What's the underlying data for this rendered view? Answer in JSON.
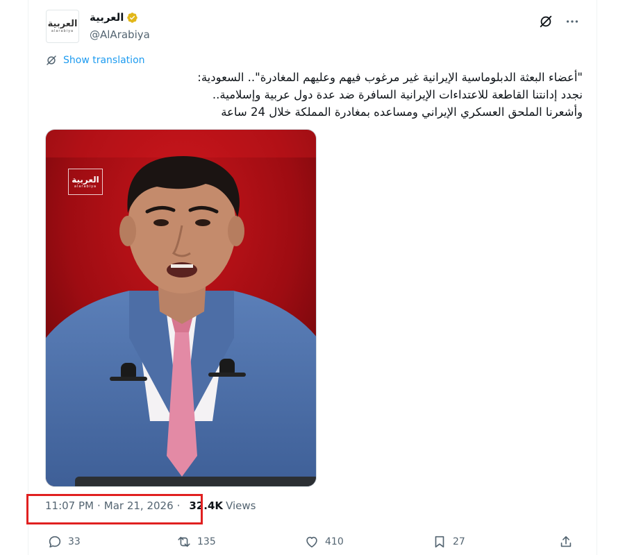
{
  "author": {
    "display_name": "العربية",
    "handle": "@AlArabiya",
    "avatar_logo_text": "العربية",
    "avatar_logo_sub": "alarabiya",
    "verified_color": "#e2b719"
  },
  "translation": {
    "label": "Show translation"
  },
  "tweet": {
    "lines": [
      "\"أعضاء البعثة الدبلوماسية الإيرانية غير مرغوب فيهم وعليهم المغادرة\".. السعودية:",
      "نجدد إدانتنا القاطعة للاعتداءات الإيرانية السافرة ضد عدة دول عربية وإسلامية..",
      "وأشعرنا الملحق العسكري الإيراني ومساعده بمغادرة المملكة خلال 24 ساعة"
    ]
  },
  "media": {
    "logo_text": "العربية",
    "logo_sub": "alarabiya"
  },
  "meta": {
    "time": "11:07 PM",
    "separator": "·",
    "date": "Mar 21, 2026",
    "views_count": "32.4K",
    "views_label": "Views"
  },
  "actions": {
    "replies": "33",
    "reposts": "135",
    "likes": "410",
    "bookmarks": "27"
  },
  "colors": {
    "accent": "#1d9bf0",
    "text_secondary": "#536471",
    "highlight": "#e02020"
  }
}
